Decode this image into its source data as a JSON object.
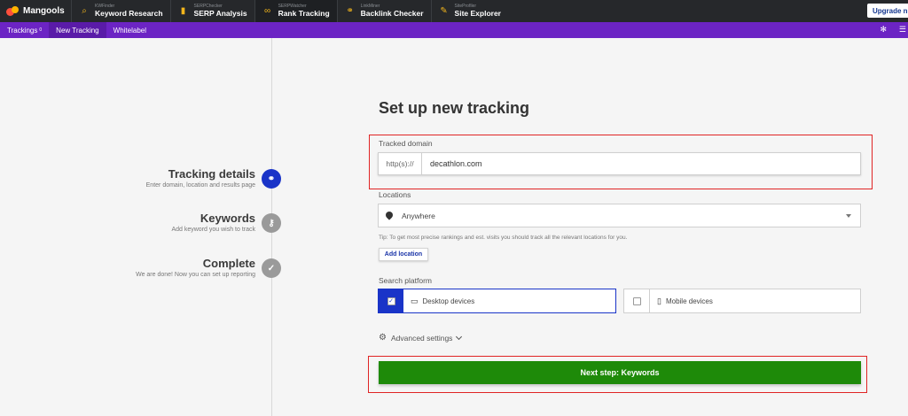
{
  "app": {
    "logo": "Mangools",
    "tools": [
      {
        "sub": "KWFinder",
        "name": "Keyword Research",
        "icon": "magnifier-icon"
      },
      {
        "sub": "SERPChecker",
        "name": "SERP Analysis",
        "icon": "bars-icon"
      },
      {
        "sub": "SERPWatcher",
        "name": "Rank Tracking",
        "icon": "glasses-icon"
      },
      {
        "sub": "LinkMiner",
        "name": "Backlink Checker",
        "icon": "link-icon"
      },
      {
        "sub": "SiteProfiler",
        "name": "Site Explorer",
        "icon": "pencil-icon"
      }
    ],
    "upgrade_label": "Upgrade n"
  },
  "subnav": {
    "trackings_label": "Trackings",
    "trackings_count": "0",
    "new_tracking": "New Tracking",
    "whitelabel": "Whitelabel"
  },
  "steps": [
    {
      "title": "Tracking details",
      "desc": "Enter domain, location and results page",
      "icon": "link-icon"
    },
    {
      "title": "Keywords",
      "desc": "Add keyword you wish to track",
      "icon": "key-icon"
    },
    {
      "title": "Complete",
      "desc": "We are done! Now you can set up reporting",
      "icon": "check-icon"
    }
  ],
  "form": {
    "heading": "Set up new tracking",
    "domain_label": "Tracked domain",
    "domain_prefix": "http(s)://",
    "domain_value": "decathlon.com",
    "locations_label": "Locations",
    "location_value": "Anywhere",
    "tip": "Tip: To get most precise rankings and est. visits you should track all the relevant locations for you.",
    "add_location": "Add location",
    "platform_label": "Search platform",
    "desktop": "Desktop devices",
    "mobile": "Mobile devices",
    "advanced": "Advanced settings",
    "next": "Next step: Keywords"
  },
  "colors": {
    "primary": "#1a34c8",
    "topbar": "#26282b",
    "subnav": "#6c24c4",
    "next": "#1e8a09",
    "highlight": "#e02424"
  }
}
